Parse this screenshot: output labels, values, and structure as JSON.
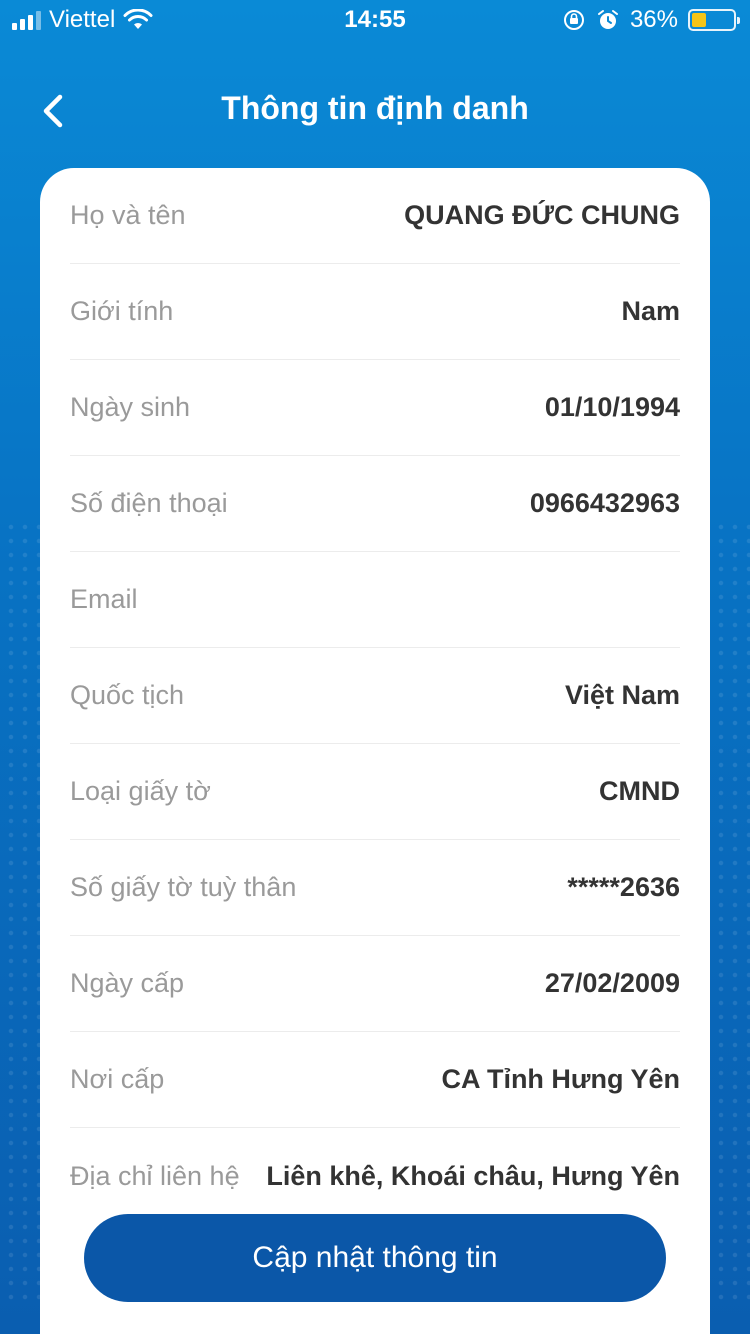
{
  "status_bar": {
    "carrier": "Viettel",
    "time": "14:55",
    "battery": "36%",
    "battery_level": 0.36
  },
  "nav": {
    "title": "Thông tin định danh"
  },
  "fields": [
    {
      "label": "Họ và tên",
      "value": "QUANG ĐỨC CHUNG"
    },
    {
      "label": "Giới tính",
      "value": "Nam"
    },
    {
      "label": "Ngày sinh",
      "value": "01/10/1994"
    },
    {
      "label": "Số điện thoại",
      "value": "0966432963"
    },
    {
      "label": "Email",
      "value": ""
    },
    {
      "label": "Quốc tịch",
      "value": "Việt Nam"
    },
    {
      "label": "Loại giấy tờ",
      "value": "CMND"
    },
    {
      "label": "Số giấy tờ tuỳ thân",
      "value": "*****2636"
    },
    {
      "label": "Ngày cấp",
      "value": "27/02/2009"
    },
    {
      "label": "Nơi cấp",
      "value": "CA Tỉnh Hưng Yên"
    },
    {
      "label": "Địa chỉ liên hệ",
      "value": "Liên khê, Khoái châu, Hưng Yên"
    }
  ],
  "update_button": {
    "label": "Cập nhật thông tin"
  },
  "colors": {
    "primary": "#0b57a8",
    "header_gradient_top": "#0a8ad6",
    "battery": "#f5c518"
  }
}
